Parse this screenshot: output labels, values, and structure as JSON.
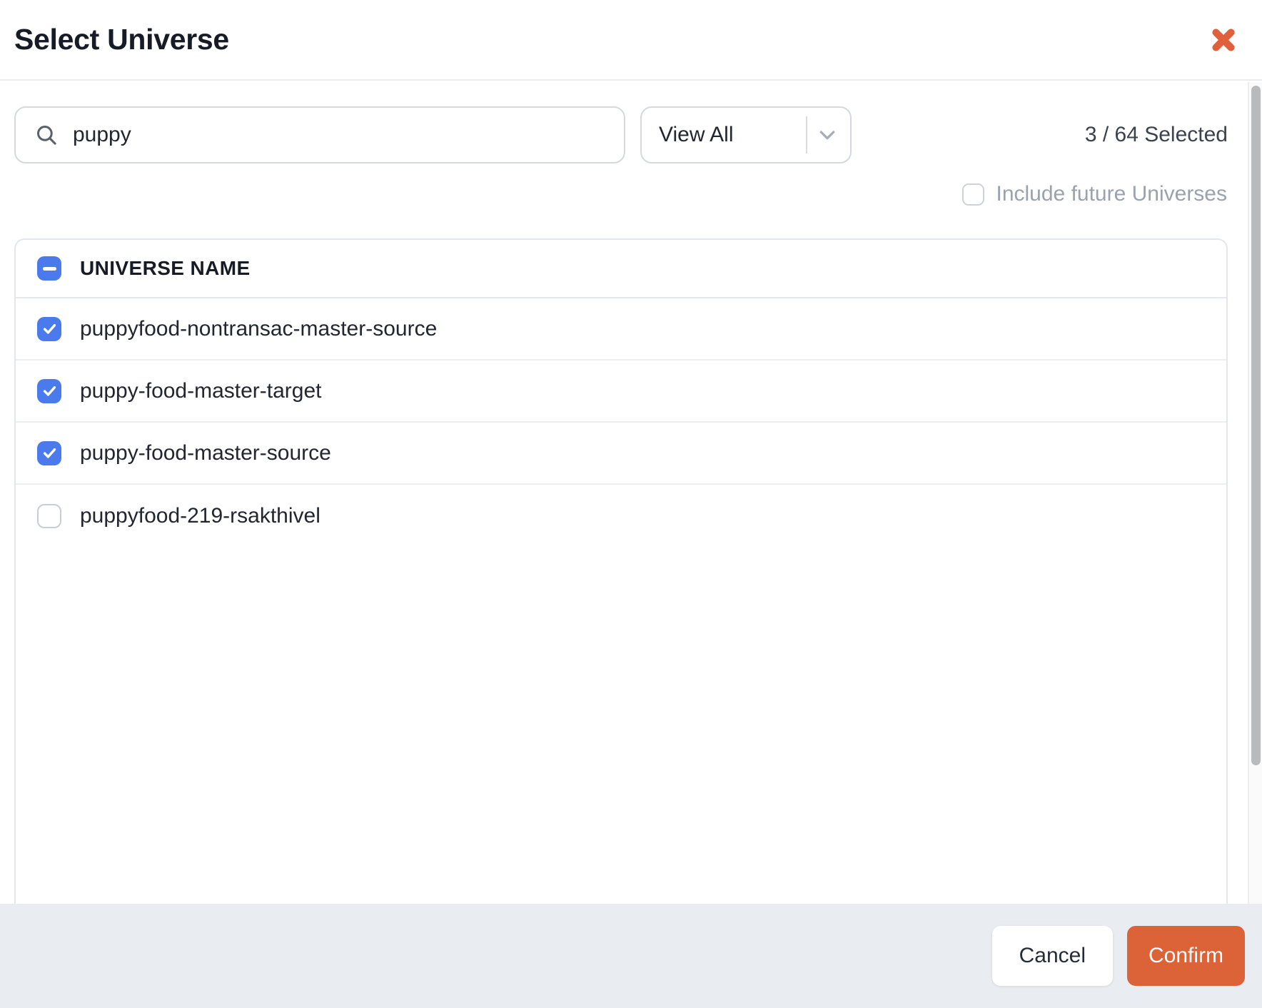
{
  "modal": {
    "title": "Select Universe"
  },
  "toolbar": {
    "search_value": "puppy",
    "filter_selected": "View All",
    "selection_summary": "3 / 64 Selected",
    "include_future": {
      "label": "Include future Universes",
      "checked": false
    }
  },
  "table": {
    "columns": [
      "UNIVERSE NAME"
    ],
    "select_all_state": "indeterminate",
    "rows": [
      {
        "name": "puppyfood-nontransac-master-source",
        "checked": true
      },
      {
        "name": "puppy-food-master-target",
        "checked": true
      },
      {
        "name": "puppy-food-master-source",
        "checked": true
      },
      {
        "name": "puppyfood-219-rsakthivel",
        "checked": false
      }
    ]
  },
  "footer": {
    "cancel_label": "Cancel",
    "confirm_label": "Confirm"
  },
  "icons": {
    "close": "x-close-icon",
    "search": "search-icon",
    "filter": "chevron-down-icon",
    "checked": "check-icon",
    "select_all": "minus-icon"
  },
  "colors": {
    "accent_orange": "#DC6238",
    "close_orange": "#E0603C",
    "checkbox_blue": "#4B7AED",
    "footer_bg": "#E9ECF1"
  }
}
